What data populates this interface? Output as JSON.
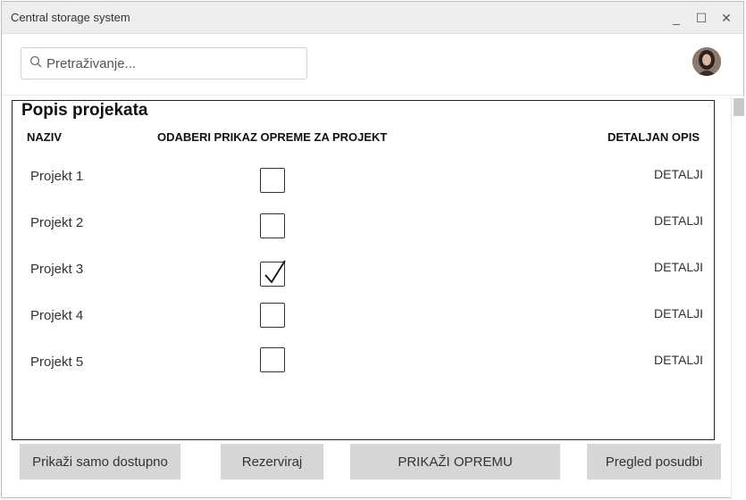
{
  "window": {
    "title": "Central storage system",
    "minimize_glyph": "_",
    "maximize_glyph": "☐",
    "close_glyph": "✕"
  },
  "search": {
    "placeholder": "Pretraživanje..."
  },
  "projects": {
    "title": "Popis projekata",
    "columns": {
      "name": "NAZIV",
      "select": "ODABERI PRIKAZ OPREME ZA PROJEKT",
      "details": "DETALJAN OPIS"
    },
    "rows": [
      {
        "name": "Projekt 1",
        "checked": false,
        "details_label": "DETALJI"
      },
      {
        "name": "Projekt 2",
        "checked": false,
        "details_label": "DETALJI"
      },
      {
        "name": "Projekt 3",
        "checked": true,
        "details_label": "DETALJI"
      },
      {
        "name": "Projekt 4",
        "checked": false,
        "details_label": "DETALJI"
      },
      {
        "name": "Projekt 5",
        "checked": false,
        "details_label": "DETALJI"
      }
    ]
  },
  "actions": {
    "show_available": "Prikaži samo dostupno",
    "reserve": "Rezerviraj",
    "show_equipment": "PRIKAŽI OPREMU",
    "loans_overview": "Pregled posudbi"
  }
}
